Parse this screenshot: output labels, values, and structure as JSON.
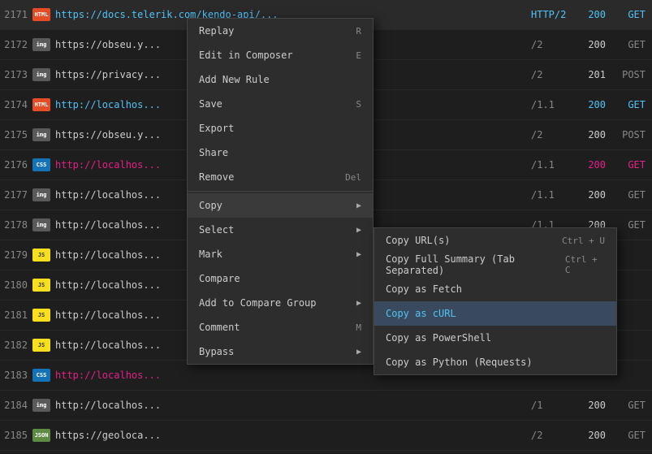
{
  "rows": [
    {
      "id": "2171",
      "icon": "HTML",
      "icon_class": "icon-html",
      "url": "https://docs.telerik.com/kendo-api/...",
      "proto": "HTTP/2",
      "status": "200",
      "status_class": "s200",
      "method": "GET",
      "method_class": "get-blue",
      "url_class": "highlight",
      "proto_class": "highlight"
    },
    {
      "id": "2172",
      "icon": "img",
      "icon_class": "icon-img",
      "url": "https://obseu.y...",
      "proto": "/2",
      "status": "200",
      "status_class": "s201",
      "method": "GET",
      "method_class": "get-gray",
      "url_class": "",
      "proto_class": ""
    },
    {
      "id": "2173",
      "icon": "img",
      "icon_class": "icon-img",
      "url": "https://privacy...",
      "proto": "/2",
      "status": "201",
      "status_class": "s201",
      "method": "POST",
      "method_class": "post-gray",
      "url_class": "",
      "proto_class": ""
    },
    {
      "id": "2174",
      "icon": "HTML",
      "icon_class": "icon-html",
      "url": "http://localhos...",
      "proto": "/1.1",
      "status": "200",
      "status_class": "s200",
      "method": "GET",
      "method_class": "get-blue",
      "url_class": "highlight",
      "proto_class": ""
    },
    {
      "id": "2175",
      "icon": "img",
      "icon_class": "icon-img",
      "url": "https://obseu.y...",
      "proto": "/2",
      "status": "200",
      "status_class": "s201",
      "method": "POST",
      "method_class": "post-gray",
      "url_class": "",
      "proto_class": ""
    },
    {
      "id": "2176",
      "icon": "CSS",
      "icon_class": "icon-css",
      "url": "http://localhos...",
      "proto": "/1.1",
      "status": "200",
      "status_class": "pink",
      "method": "GET",
      "method_class": "pink",
      "url_class": "pink",
      "proto_class": ""
    },
    {
      "id": "2177",
      "icon": "img",
      "icon_class": "icon-img",
      "url": "http://localhos...",
      "proto": "/1.1",
      "status": "200",
      "status_class": "s201",
      "method": "GET",
      "method_class": "get-gray",
      "url_class": "",
      "proto_class": ""
    },
    {
      "id": "2178",
      "icon": "img",
      "icon_class": "icon-img",
      "url": "http://localhos...",
      "proto": "/1.1",
      "status": "200",
      "status_class": "s201",
      "method": "GET",
      "method_class": "get-gray",
      "url_class": "",
      "proto_class": ""
    },
    {
      "id": "2179",
      "icon": "JS",
      "icon_class": "icon-js",
      "url": "http://localhos...",
      "proto": "",
      "status": "",
      "status_class": "",
      "method": "",
      "method_class": "",
      "url_class": "",
      "proto_class": ""
    },
    {
      "id": "2180",
      "icon": "JS",
      "icon_class": "icon-js",
      "url": "http://localhos...",
      "proto": "",
      "status": "",
      "status_class": "",
      "method": "",
      "method_class": "",
      "url_class": "",
      "proto_class": ""
    },
    {
      "id": "2181",
      "icon": "JS",
      "icon_class": "icon-js",
      "url": "http://localhos...",
      "proto": "",
      "status": "",
      "status_class": "",
      "method": "",
      "method_class": "",
      "url_class": "",
      "proto_class": ""
    },
    {
      "id": "2182",
      "icon": "JS",
      "icon_class": "icon-js",
      "url": "http://localhos...",
      "proto": "",
      "status": "",
      "status_class": "",
      "method": "",
      "method_class": "",
      "url_class": "",
      "proto_class": ""
    },
    {
      "id": "2183",
      "icon": "CSS",
      "icon_class": "icon-css",
      "url": "http://localhos...",
      "proto": "",
      "status": "",
      "status_class": "",
      "method": "",
      "method_class": "",
      "url_class": "pink",
      "proto_class": ""
    },
    {
      "id": "2184",
      "icon": "img",
      "icon_class": "icon-img",
      "url": "http://localhos...",
      "proto": "/1",
      "status": "200",
      "status_class": "s201",
      "method": "GET",
      "method_class": "get-gray",
      "url_class": "",
      "proto_class": ""
    },
    {
      "id": "2185",
      "icon": "JSON",
      "icon_class": "icon-json",
      "url": "https://geoloca...",
      "proto": "/2",
      "status": "200",
      "status_class": "s201",
      "method": "GET",
      "method_class": "get-gray",
      "url_class": "",
      "proto_class": ""
    }
  ],
  "context_menu": {
    "items": [
      {
        "label": "Replay",
        "shortcut": "R",
        "has_arrow": false
      },
      {
        "label": "Edit in Composer",
        "shortcut": "E",
        "has_arrow": false
      },
      {
        "label": "Add New Rule",
        "shortcut": "",
        "has_arrow": false
      },
      {
        "label": "Save",
        "shortcut": "S",
        "has_arrow": false
      },
      {
        "label": "Export",
        "shortcut": "",
        "has_arrow": false
      },
      {
        "label": "Share",
        "shortcut": "",
        "has_arrow": false
      },
      {
        "label": "Remove",
        "shortcut": "Del",
        "has_arrow": false
      },
      {
        "label": "Copy",
        "shortcut": "",
        "has_arrow": true
      },
      {
        "label": "Select",
        "shortcut": "",
        "has_arrow": true
      },
      {
        "label": "Mark",
        "shortcut": "",
        "has_arrow": true
      },
      {
        "label": "Compare",
        "shortcut": "",
        "has_arrow": false
      },
      {
        "label": "Add to Compare Group",
        "shortcut": "",
        "has_arrow": true
      },
      {
        "label": "Comment",
        "shortcut": "M",
        "has_arrow": false
      },
      {
        "label": "Bypass",
        "shortcut": "",
        "has_arrow": true
      }
    ]
  },
  "submenu": {
    "items": [
      {
        "label": "Copy URL(s)",
        "shortcut": "Ctrl + U",
        "active": false
      },
      {
        "label": "Copy Full Summary (Tab Separated)",
        "shortcut": "Ctrl + C",
        "active": false
      },
      {
        "label": "Copy as Fetch",
        "shortcut": "",
        "active": false
      },
      {
        "label": "Copy as cURL",
        "shortcut": "",
        "active": true
      },
      {
        "label": "Copy as PowerShell",
        "shortcut": "",
        "active": false
      },
      {
        "label": "Copy as Python (Requests)",
        "shortcut": "",
        "active": false
      }
    ]
  }
}
